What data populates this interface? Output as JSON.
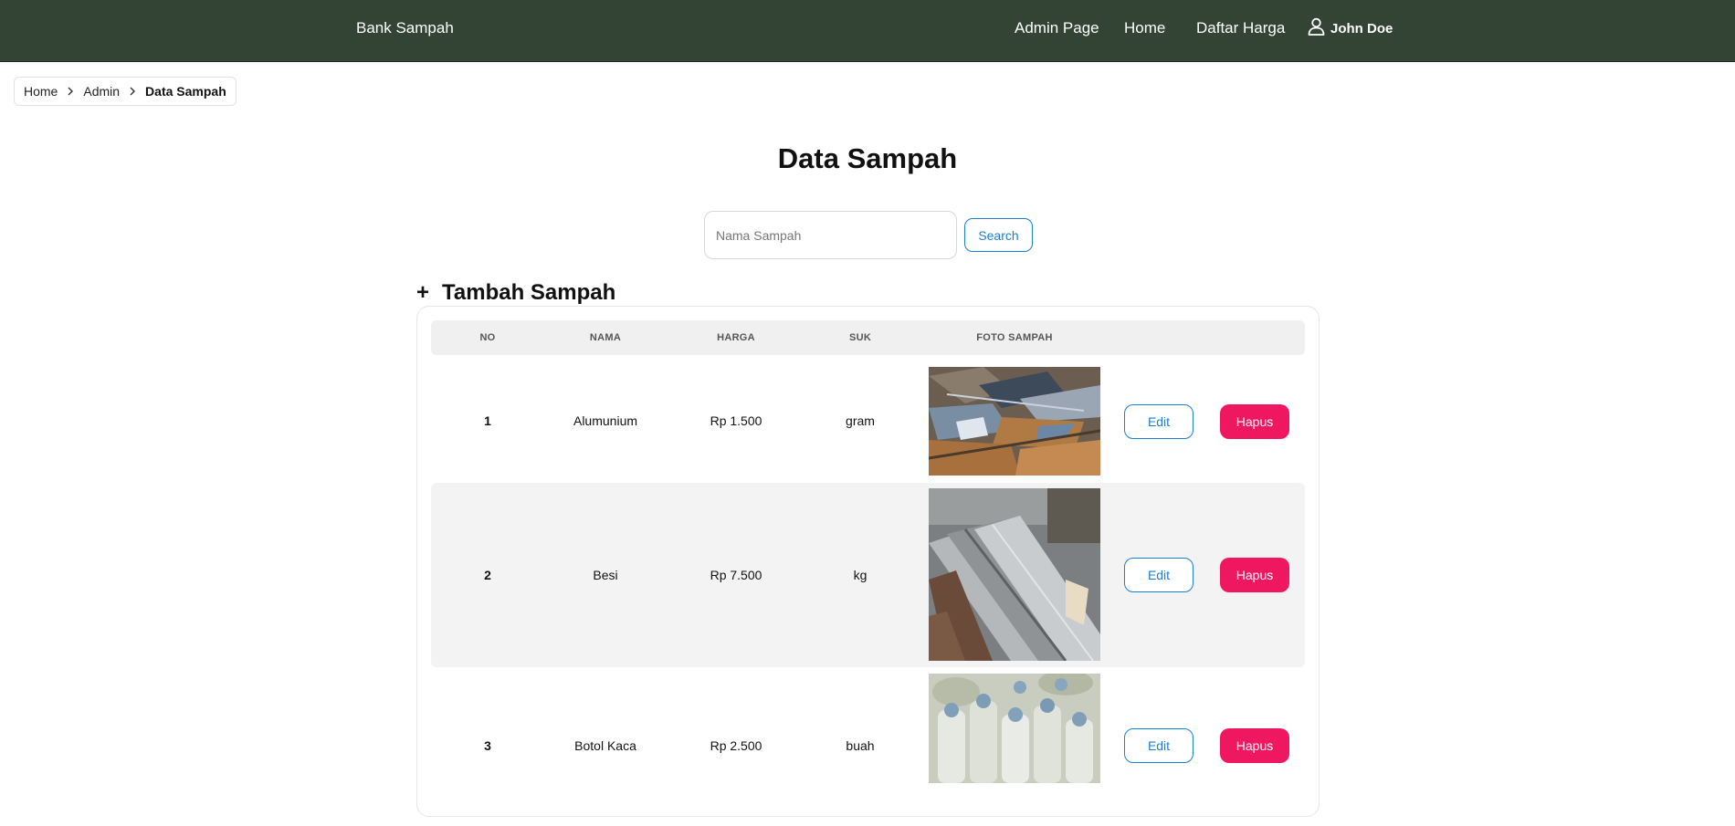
{
  "nav": {
    "brand": "Bank Sampah",
    "links": [
      "Admin Page",
      "Home",
      "Daftar Harga"
    ],
    "user": "John Doe",
    "bg_color": "#344434"
  },
  "breadcrumb": {
    "items": [
      "Home",
      "Admin"
    ],
    "current": "Data Sampah"
  },
  "page": {
    "title": "Data Sampah"
  },
  "search": {
    "placeholder": "Nama Sampah",
    "value": "",
    "button": "Search"
  },
  "add": {
    "icon": "plus-icon",
    "label": "Tambah Sampah"
  },
  "table": {
    "headers": [
      "NO",
      "NAMA",
      "HARGA",
      "SUK",
      "FOTO SAMPAH"
    ],
    "rows": [
      {
        "no": "1",
        "nama": "Alumunium",
        "harga": "Rp 1.500",
        "satuan": "gram",
        "photo": "aluminium-scrap-photo"
      },
      {
        "no": "2",
        "nama": "Besi",
        "harga": "Rp 7.500",
        "satuan": "kg",
        "photo": "iron-bars-photo"
      },
      {
        "no": "3",
        "nama": "Botol Kaca",
        "harga": "Rp 2.500",
        "satuan": "buah",
        "photo": "glass-bottles-photo"
      }
    ],
    "edit_label": "Edit",
    "delete_label": "Hapus"
  },
  "colors": {
    "accent": "#1a7fd6",
    "danger": "#ef1760"
  }
}
